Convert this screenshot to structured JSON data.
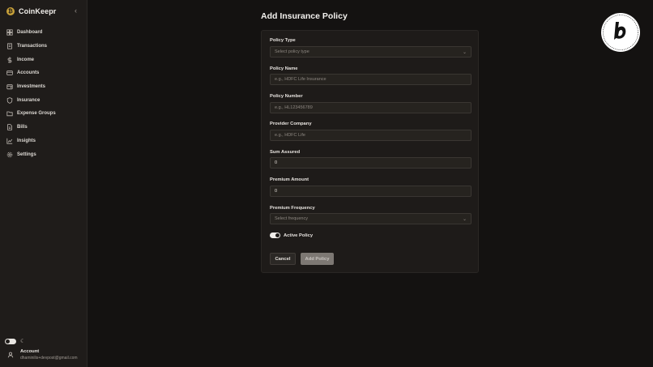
{
  "app": {
    "name": "CoinKeepr",
    "logo_glyph": "₿"
  },
  "sidebar": {
    "collapse_glyph": "‹",
    "items": [
      {
        "label": "Dashboard",
        "icon": "dashboard-icon"
      },
      {
        "label": "Transactions",
        "icon": "receipt-icon"
      },
      {
        "label": "Income",
        "icon": "dollar-icon"
      },
      {
        "label": "Accounts",
        "icon": "credit-card-icon"
      },
      {
        "label": "Investments",
        "icon": "wallet-icon"
      },
      {
        "label": "Insurance",
        "icon": "shield-icon"
      },
      {
        "label": "Expense Groups",
        "icon": "folder-icon"
      },
      {
        "label": "Bills",
        "icon": "file-icon"
      },
      {
        "label": "Insights",
        "icon": "chart-icon"
      },
      {
        "label": "Settings",
        "icon": "gear-icon"
      }
    ],
    "theme_icon": "moon-icon",
    "account": {
      "title": "Account",
      "email": "dhaminilis+devpost@gmail.com"
    }
  },
  "form": {
    "title": "Add Insurance Policy",
    "policy_type": {
      "label": "Policy Type",
      "placeholder": "Select policy type"
    },
    "policy_name": {
      "label": "Policy Name",
      "placeholder": "e.g., HDFC Life Insurance"
    },
    "policy_number": {
      "label": "Policy Number",
      "placeholder": "e.g., HL123456789"
    },
    "provider_company": {
      "label": "Provider Company",
      "placeholder": "e.g., HDFC Life"
    },
    "sum_assured": {
      "label": "Sum Assured",
      "value": "0"
    },
    "premium_amount": {
      "label": "Premium Amount",
      "value": "0"
    },
    "premium_frequency": {
      "label": "Premium Frequency",
      "placeholder": "Select frequency"
    },
    "active_policy": {
      "label": "Active Policy",
      "enabled": true
    },
    "cancel_label": "Cancel",
    "submit_label": "Add Policy"
  },
  "colors": {
    "background": "#141211",
    "sidebar": "#1f1c1a",
    "card": "#1e1b19",
    "input": "#26231f",
    "brand_gold": "#c9a23a"
  }
}
